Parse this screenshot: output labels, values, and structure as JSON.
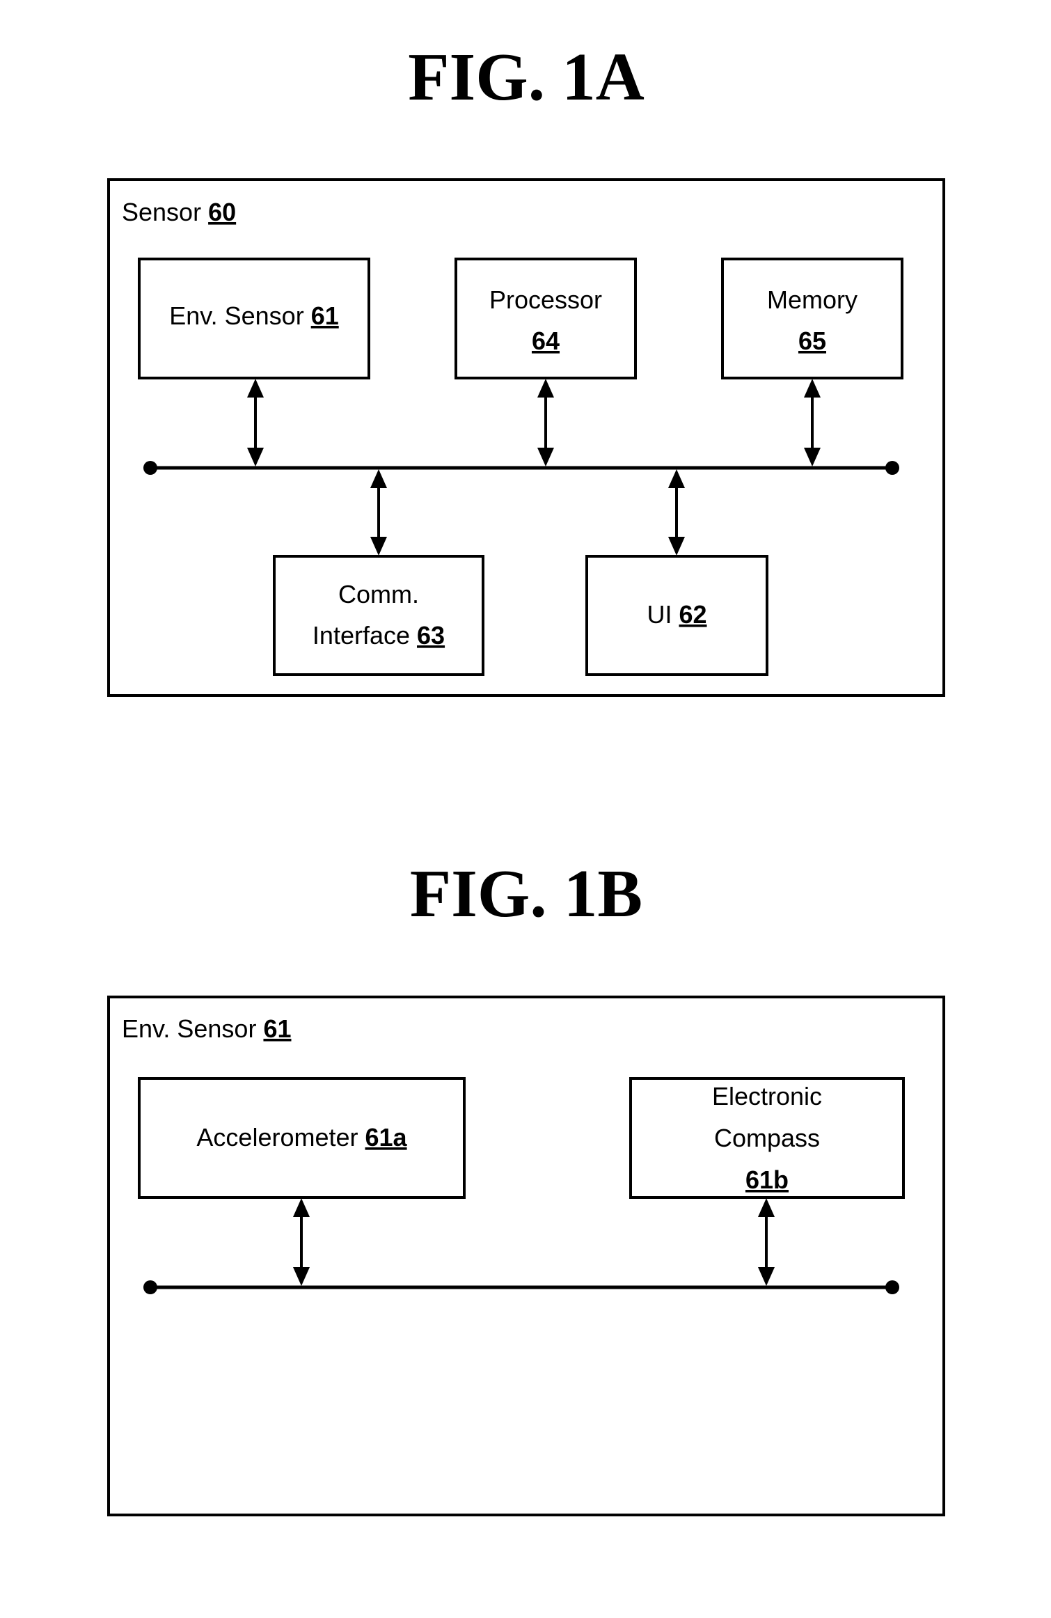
{
  "figures": [
    {
      "id": "fig1a",
      "title": "FIG. 1A",
      "container": {
        "label": "Sensor",
        "ref": "60"
      },
      "components": [
        {
          "key": "env_sensor",
          "lines": [
            {
              "text": "Env. Sensor ",
              "ref": "61"
            }
          ]
        },
        {
          "key": "processor",
          "lines": [
            {
              "text": "Processor",
              "ref": ""
            },
            {
              "text": "",
              "ref": "64"
            }
          ]
        },
        {
          "key": "memory",
          "lines": [
            {
              "text": "Memory",
              "ref": ""
            },
            {
              "text": "",
              "ref": "65"
            }
          ]
        },
        {
          "key": "comm_interface",
          "lines": [
            {
              "text": "Comm.",
              "ref": ""
            },
            {
              "text": "Interface  ",
              "ref": "63"
            }
          ]
        },
        {
          "key": "ui",
          "lines": [
            {
              "text": "UI ",
              "ref": "62"
            }
          ]
        }
      ],
      "connections": [
        {
          "from": "env_sensor",
          "to": "bus",
          "type": "bidirectional"
        },
        {
          "from": "processor",
          "to": "bus",
          "type": "bidirectional"
        },
        {
          "from": "memory",
          "to": "bus",
          "type": "bidirectional"
        },
        {
          "from": "comm_interface",
          "to": "bus",
          "type": "bidirectional"
        },
        {
          "from": "ui",
          "to": "bus",
          "type": "bidirectional"
        }
      ]
    },
    {
      "id": "fig1b",
      "title": "FIG. 1B",
      "container": {
        "label": "Env. Sensor",
        "ref": "61"
      },
      "components": [
        {
          "key": "accelerometer",
          "lines": [
            {
              "text": "Accelerometer ",
              "ref": "61a"
            }
          ]
        },
        {
          "key": "electronic_compass",
          "lines": [
            {
              "text": "Electronic",
              "ref": ""
            },
            {
              "text": "Compass",
              "ref": ""
            },
            {
              "text": "",
              "ref": "61b"
            }
          ]
        }
      ],
      "connections": [
        {
          "from": "accelerometer",
          "to": "bus",
          "type": "bidirectional"
        },
        {
          "from": "electronic_compass",
          "to": "bus",
          "type": "bidirectional"
        }
      ]
    }
  ]
}
